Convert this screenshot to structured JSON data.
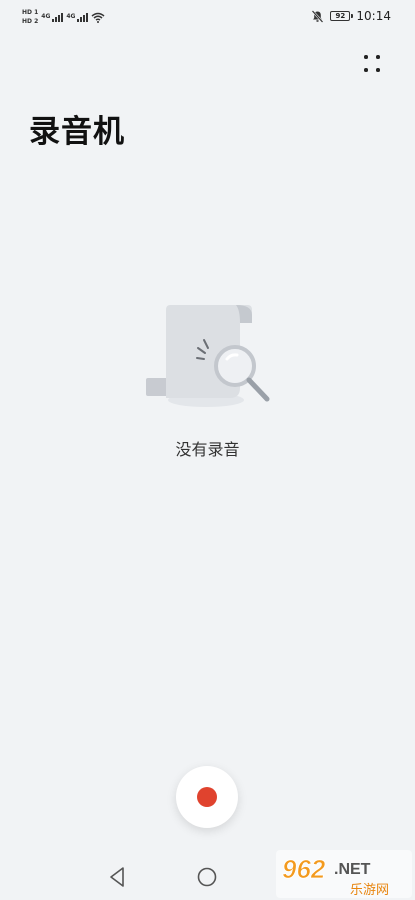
{
  "status_bar": {
    "sim1_label": "HD 1",
    "sim2_label": "HD 2",
    "network1": "4G",
    "network2": "4G",
    "battery_level": "92",
    "time": "10:14"
  },
  "header": {
    "title": "录音机",
    "more_icon": "more-options-icon"
  },
  "empty_state": {
    "illustration": "document-search-illustration",
    "message": "没有录音"
  },
  "record": {
    "icon": "record-dot-icon",
    "color": "#e0432e"
  },
  "navigation": {
    "back_icon": "back-triangle-icon",
    "home_icon": "home-circle-icon"
  },
  "watermark": {
    "logo_text": "962.NET",
    "sub_text": "乐游网"
  },
  "colors": {
    "background": "#f1f3f5",
    "accent": "#e0432e"
  }
}
